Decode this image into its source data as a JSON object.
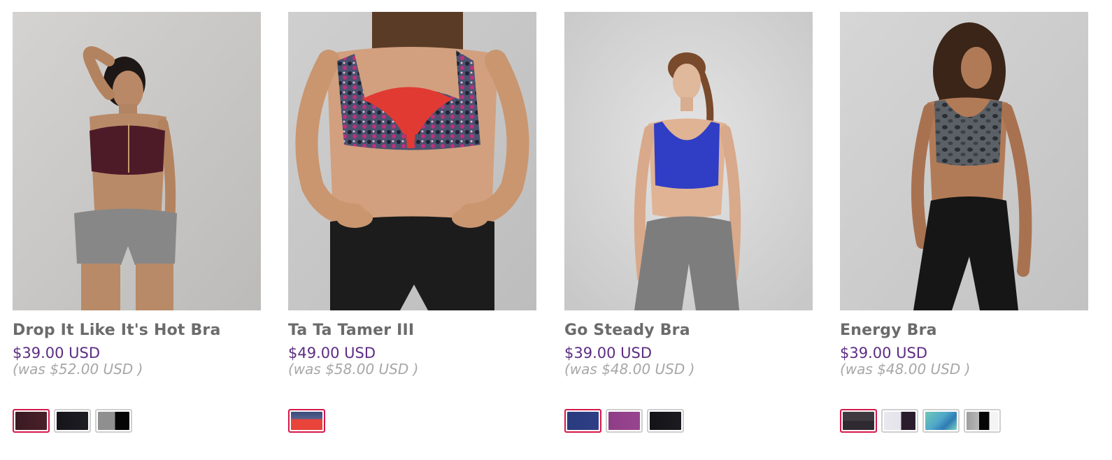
{
  "products": [
    {
      "name": "Drop It Like It's Hot Bra",
      "price": "$39.00 USD",
      "was": "(was $52.00 USD )",
      "image_alt": "Drop It Like It's Hot Bra",
      "swatches": [
        {
          "style": "linear-gradient(90deg,#3a1a22,#4a2029)",
          "selected": true
        },
        {
          "style": "linear-gradient(90deg,#15151a,#1d1d24)",
          "selected": false
        },
        {
          "style": "linear-gradient(90deg,#8f8f8f 0%,#8f8f8f 55%,#050505 55%,#050505 100%)",
          "selected": false
        }
      ]
    },
    {
      "name": "Ta Ta Tamer III",
      "price": "$49.00 USD",
      "was": "(was $58.00 USD )",
      "image_alt": "Ta Ta Tamer III",
      "swatches": [
        {
          "style": "linear-gradient(180deg,#3b4a7a 0%,#56618e 40%,#e8443a 40%,#e8443a 100%)",
          "selected": true
        }
      ]
    },
    {
      "name": "Go Steady Bra",
      "price": "$39.00 USD",
      "was": "(was $48.00 USD )",
      "image_alt": "Go Steady Bra",
      "swatches": [
        {
          "style": "linear-gradient(90deg,#2a3a7e,#2e3f86)",
          "selected": true
        },
        {
          "style": "linear-gradient(90deg,#8e3e86,#98458f)",
          "selected": false
        },
        {
          "style": "linear-gradient(90deg,#131318,#1b1b21)",
          "selected": false
        }
      ]
    },
    {
      "name": "Energy Bra",
      "price": "$39.00 USD",
      "was": "(was $48.00 USD )",
      "image_alt": "Energy Bra",
      "swatches": [
        {
          "style": "linear-gradient(180deg,#3e3a3f 0%,#3e3a3f 50%,#2f2a31 50%,#2f2a31 100%)",
          "selected": true
        },
        {
          "style": "linear-gradient(90deg,#e9e8ef 0%,#e4e3ea 55%,#2b1c2d 55%,#2b1c2d 100%)",
          "selected": false
        },
        {
          "style": "linear-gradient(135deg,#6fc8b5 0%,#4fa8c9 45%,#2f7bb3 70%,#7cd4c0 100%)",
          "selected": false
        },
        {
          "style": "linear-gradient(90deg,#9d9d9d 0%,#b8b8b8 40%,#060606 40%,#060606 72%,#f4f4f4 72%,#f4f4f4 100%)",
          "selected": false
        }
      ]
    }
  ],
  "colors": {
    "name": "#6b6b6b",
    "price": "#5c2d82",
    "was": "#a7a7a7",
    "swatch_selected_border": "#d6184a",
    "swatch_border": "#cfcfcf"
  }
}
